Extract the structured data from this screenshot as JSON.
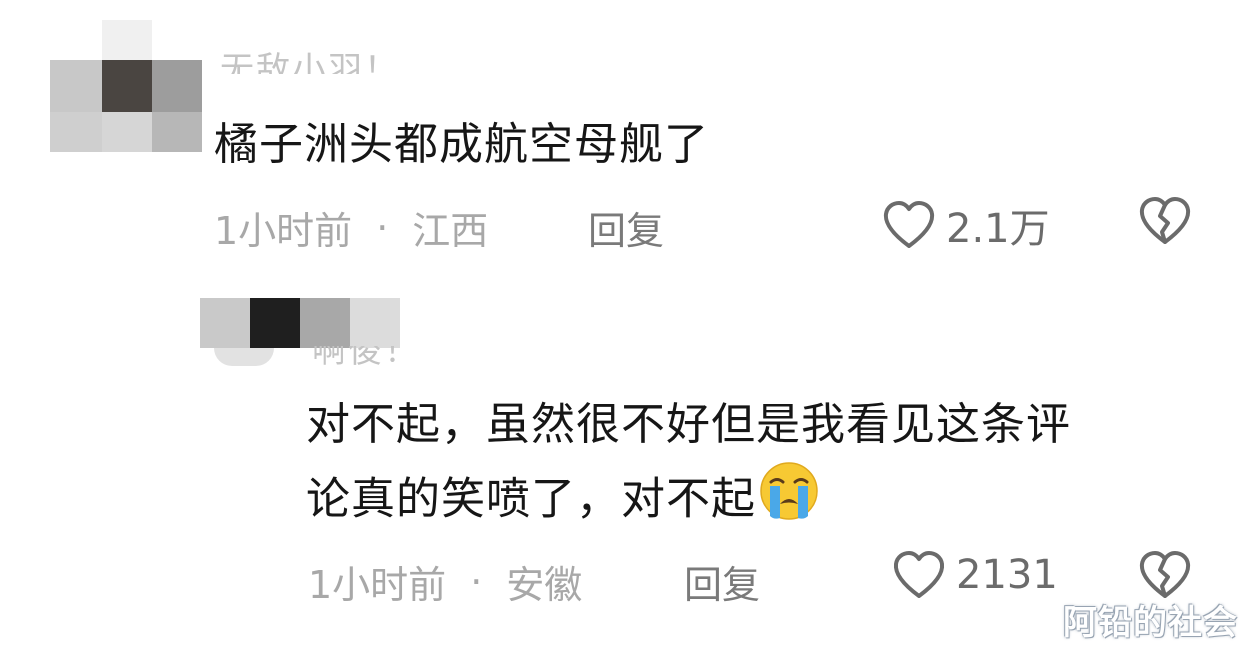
{
  "comments": [
    {
      "username": "无敌小羽！",
      "text_lines": [
        "橘子洲头都成航空母舰了"
      ],
      "time": "1小时前",
      "separator": "·",
      "location": "江西",
      "reply_label": "回复",
      "like_count": "2.1万"
    },
    {
      "username": "啊俊！",
      "text_lines": [
        "对不起，虽然很不好但是我看见这条评",
        "论真的笑喷了，对不起"
      ],
      "time": "1小时前",
      "separator": "·",
      "location": "安徽",
      "reply_label": "回复",
      "like_count": "2131"
    }
  ],
  "watermark": "阿铅的社会",
  "icons": {
    "like": "heart-outline-icon",
    "dislike": "broken-heart-icon",
    "emoji": "loudly-crying-face-emoji"
  },
  "colors": {
    "text": "#161616",
    "meta": "#a8a8a8",
    "icon": "#6b6b6b",
    "emoji_face": "#f7c933",
    "emoji_tears": "#4aa8e8"
  }
}
